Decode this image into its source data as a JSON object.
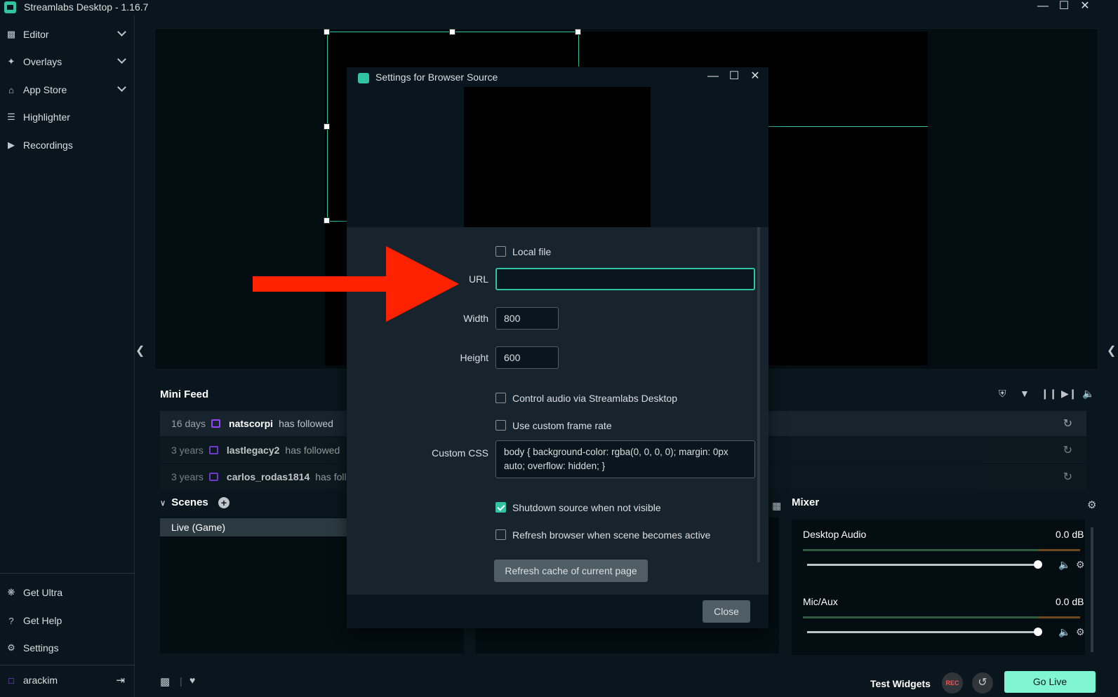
{
  "app": {
    "title": "Streamlabs Desktop - 1.16.7"
  },
  "sidebar": {
    "items": [
      {
        "label": "Editor",
        "icon": "editor-icon"
      },
      {
        "label": "Overlays",
        "icon": "overlays-icon"
      },
      {
        "label": "App Store",
        "icon": "store-icon"
      },
      {
        "label": "Highlighter",
        "icon": "highlighter-icon"
      },
      {
        "label": "Recordings",
        "icon": "play-icon"
      }
    ],
    "bottom": [
      {
        "label": "Get Ultra",
        "icon": "ultra-icon"
      },
      {
        "label": "Get Help",
        "icon": "help-icon"
      },
      {
        "label": "Settings",
        "icon": "gear-icon"
      }
    ],
    "user": {
      "name": "arackim"
    }
  },
  "minifeed": {
    "title": "Mini Feed",
    "rows": [
      {
        "time": "16 days",
        "user": "natscorpi",
        "action": "has followed"
      },
      {
        "time": "3 years",
        "user": "lastlegacy2",
        "action": "has followed"
      },
      {
        "time": "3 years",
        "user": "carlos_rodas1814",
        "action": "has follo"
      }
    ]
  },
  "scenes": {
    "title": "Scenes",
    "items": [
      "Live (Game)"
    ]
  },
  "mixer": {
    "title": "Mixer",
    "channels": [
      {
        "name": "Desktop Audio",
        "db": "0.0 dB"
      },
      {
        "name": "Mic/Aux",
        "db": "0.0 dB"
      }
    ]
  },
  "bottombar": {
    "test_widgets": "Test Widgets",
    "rec": "REC",
    "go_live": "Go Live"
  },
  "dialog": {
    "title": "Settings for Browser Source",
    "local_file": "Local file",
    "url_label": "URL",
    "url_value": "",
    "width_label": "Width",
    "width_value": "800",
    "height_label": "Height",
    "height_value": "600",
    "control_audio": "Control audio via Streamlabs Desktop",
    "custom_frame_rate": "Use custom frame rate",
    "custom_css_label": "Custom CSS",
    "custom_css_value": "body { background-color: rgba(0, 0, 0, 0); margin: 0px auto; overflow: hidden; }",
    "shutdown": "Shutdown source when not visible",
    "refresh_browser": "Refresh browser when scene becomes active",
    "refresh_cache": "Refresh cache of current page",
    "close": "Close",
    "shutdown_checked": true
  },
  "colors": {
    "accent": "#31c3a2",
    "go_live": "#80f5d2",
    "arrow": "#ff2200",
    "twitch": "#9146ff"
  }
}
